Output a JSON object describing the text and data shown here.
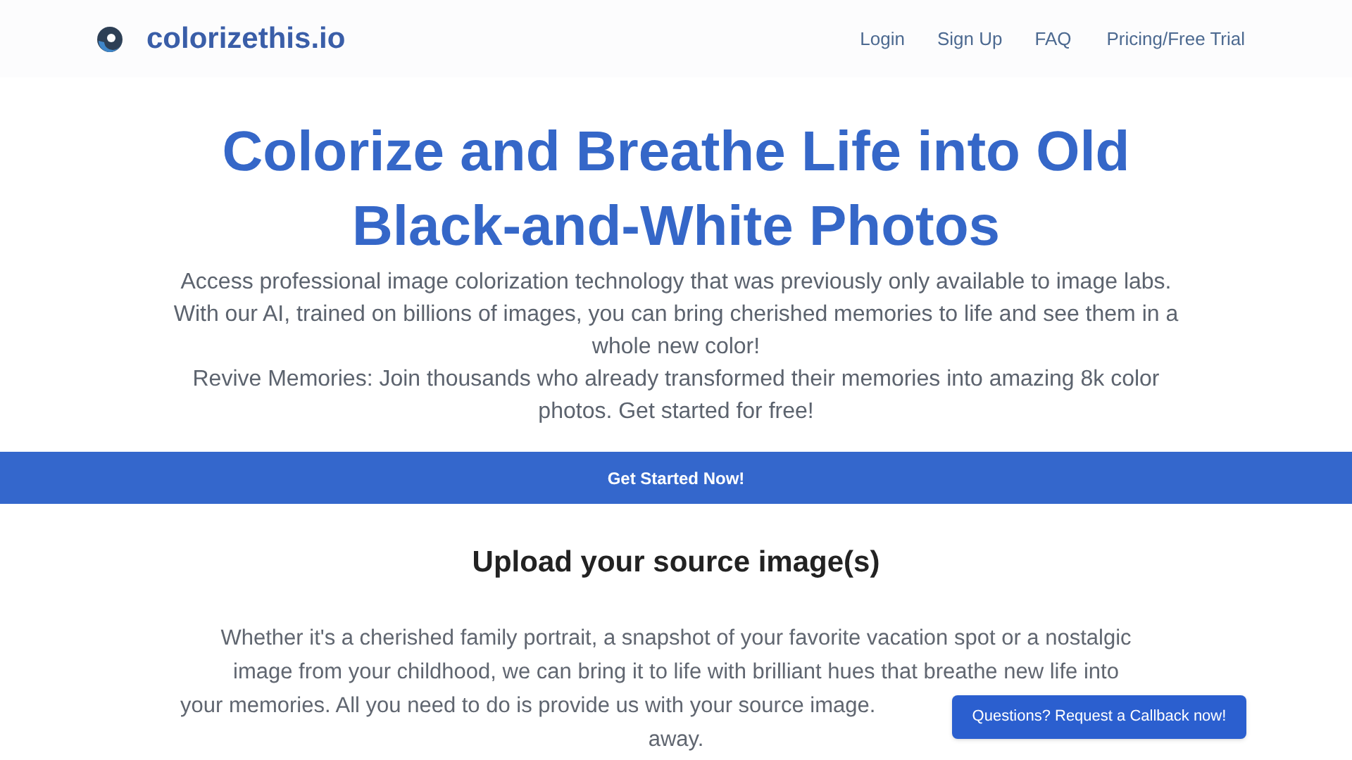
{
  "header": {
    "brand": "colorizethis.io",
    "nav": [
      "Login",
      "Sign Up",
      "FAQ",
      "Pricing/Free Trial"
    ]
  },
  "hero": {
    "title": "Colorize and Breathe Life into Old Black-and-White Photos",
    "paragraphs": [
      "Access professional image colorization technology that was previously only available to image labs. With our AI, trained on billions of images, you can bring cherished memories to life and see them in a whole new color!",
      "Revive Memories: Join thousands who already transformed their memories into amazing 8k color photos. Get started for free!"
    ]
  },
  "cta": {
    "label": "Get Started Now!"
  },
  "upload": {
    "heading": "Upload your source image(s)",
    "lines": [
      "Whether it's a cherished family portrait, a snapshot of your favorite vacation spot or a nostalgic",
      "image from your childhood, we can bring it to life with brilliant hues that breathe new life into",
      "your memories. All you need to do is provide us with your source image.",
      "away."
    ]
  },
  "callback": {
    "label": "Questions? Request a Callback now!"
  }
}
